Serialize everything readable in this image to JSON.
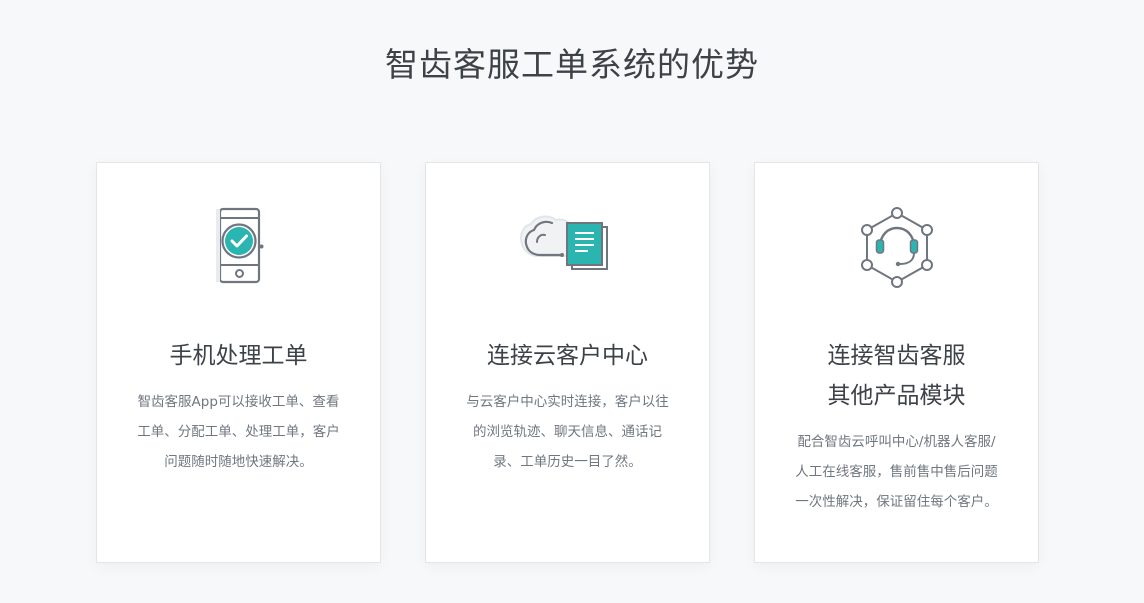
{
  "section": {
    "title": "智齿客服工单系统的优势"
  },
  "cards": [
    {
      "icon": "mobile-check-icon",
      "title_lines": [
        "手机处理工单"
      ],
      "desc_lines": [
        "智齿客服App可以接收工单、查看",
        "工单、分配工单、处理工单，客户",
        "问题随时随地快速解决。"
      ]
    },
    {
      "icon": "cloud-document-icon",
      "title_lines": [
        "连接云客户中心"
      ],
      "desc_lines": [
        "与云客户中心实时连接，客户以往",
        "的浏览轨迹、聊天信息、通话记",
        "录、工单历史一目了然。"
      ]
    },
    {
      "icon": "headset-network-icon",
      "title_lines": [
        "连接智齿客服",
        "其他产品模块"
      ],
      "desc_lines": [
        "配合智齿云呼叫中心/机器人客服/",
        "人工在线客服，售前售中售后问题",
        "一次性解决，保证留住每个客户。"
      ]
    }
  ],
  "colors": {
    "accent": "#2bb5b0",
    "icon_stroke": "#6f7680",
    "background": "#f7f8fa"
  }
}
